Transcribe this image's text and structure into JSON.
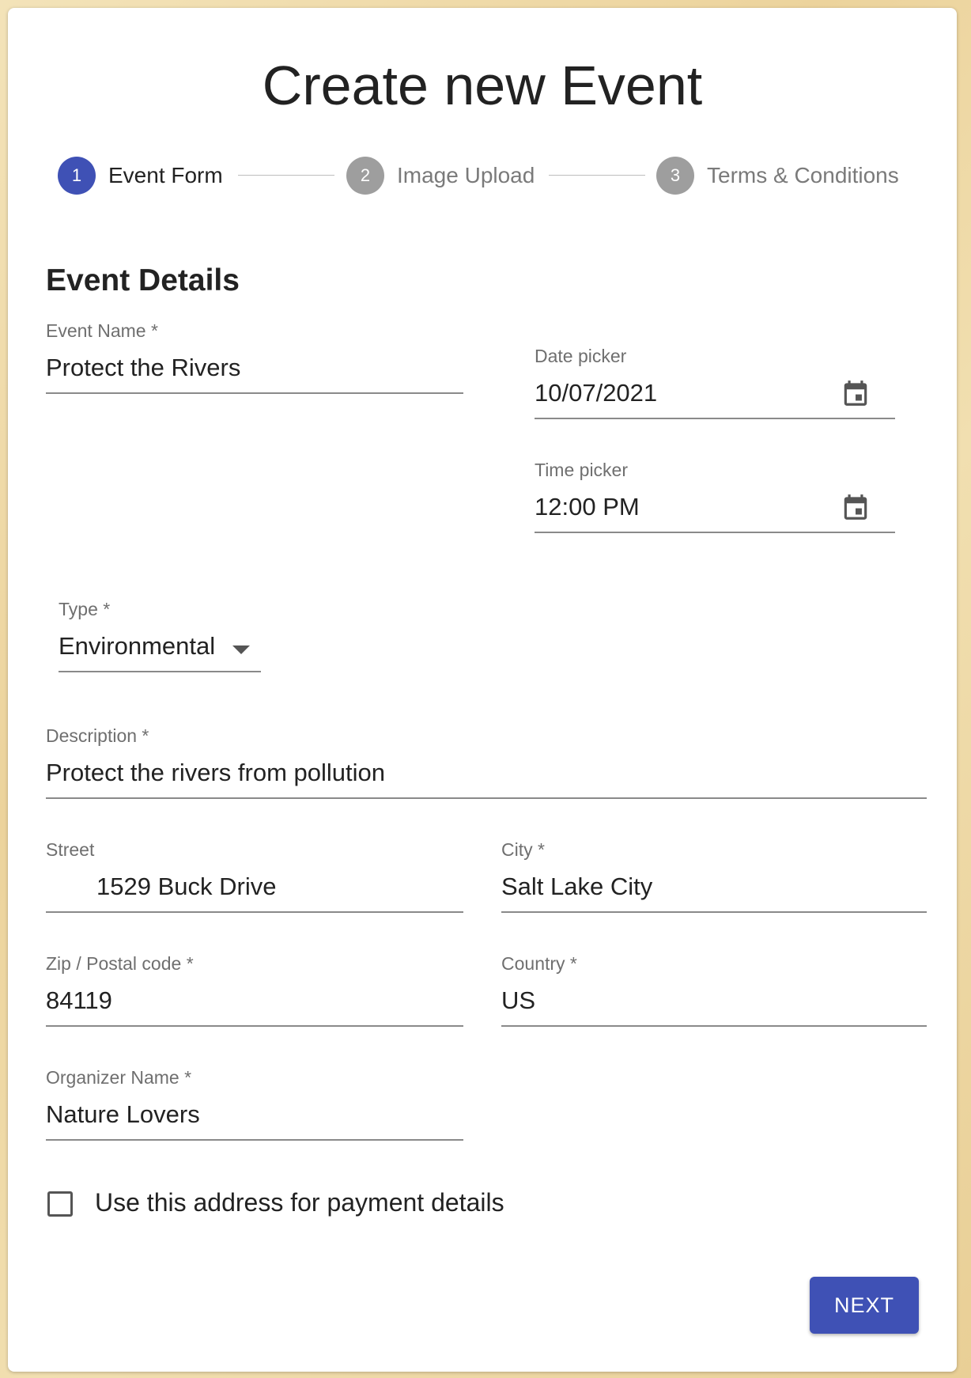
{
  "page": {
    "title": "Create new Event",
    "section_title": "Event Details"
  },
  "stepper": {
    "steps": [
      {
        "number": "1",
        "label": "Event Form",
        "state": "active"
      },
      {
        "number": "2",
        "label": "Image Upload",
        "state": "inactive"
      },
      {
        "number": "3",
        "label": "Terms & Conditions",
        "state": "inactive"
      }
    ]
  },
  "form": {
    "event_name": {
      "label": "Event Name *",
      "value": "Protect the Rivers"
    },
    "date_picker": {
      "label": "Date picker",
      "value": "10/07/2021",
      "icon": "calendar-icon"
    },
    "time_picker": {
      "label": "Time picker",
      "value": "12:00 PM",
      "icon": "calendar-icon"
    },
    "type": {
      "label": "Type *",
      "value": "Environmental",
      "icon": "dropdown-arrow-icon"
    },
    "description": {
      "label": "Description *",
      "value": "Protect the rivers from pollution"
    },
    "street": {
      "label": "Street",
      "value": "1529 Buck Drive"
    },
    "city": {
      "label": "City *",
      "value": "Salt Lake City"
    },
    "zip": {
      "label": "Zip / Postal code *",
      "value": "84119"
    },
    "country": {
      "label": "Country *",
      "value": "US"
    },
    "organizer": {
      "label": "Organizer Name *",
      "value": "Nature Lovers"
    },
    "payment_checkbox": {
      "label": "Use this address for payment details",
      "checked": false
    }
  },
  "actions": {
    "next_label": "NEXT"
  },
  "colors": {
    "primary": "#3f51b5",
    "inactive_step": "#9e9e9e"
  }
}
